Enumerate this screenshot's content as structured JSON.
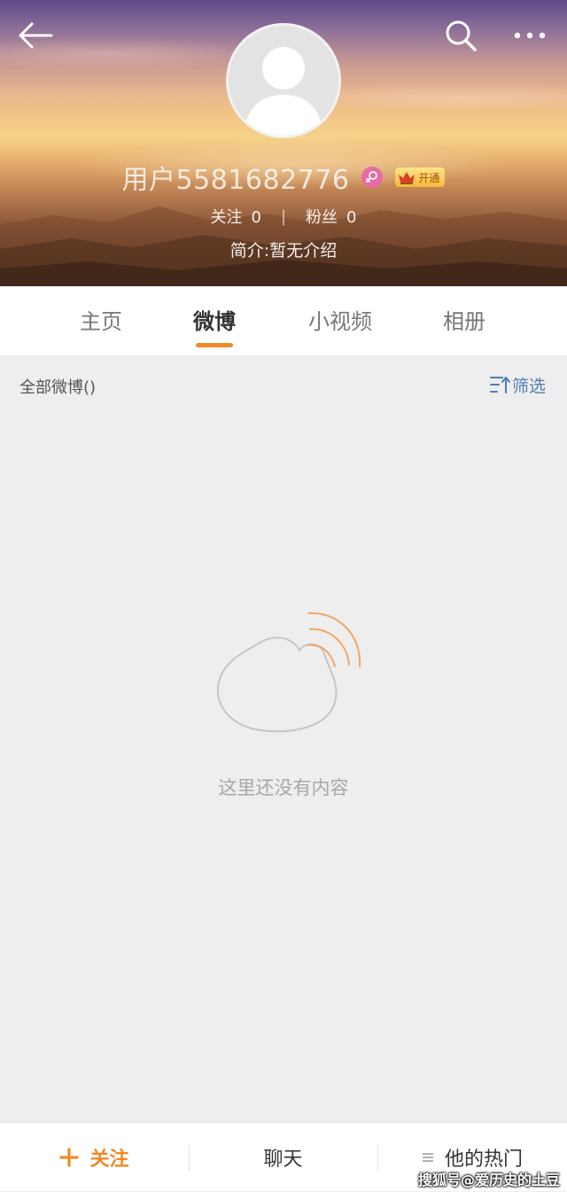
{
  "profile": {
    "username": "用户5581682776",
    "follow_label": "关注",
    "follow_count": "0",
    "fans_label": "粉丝",
    "fans_count": "0",
    "stats_separator": "|",
    "bio": "简介:暂无介绍",
    "vip_label": "开通"
  },
  "tabs": [
    {
      "label": "主页"
    },
    {
      "label": "微博",
      "active": true
    },
    {
      "label": "小视频"
    },
    {
      "label": "相册"
    }
  ],
  "feed": {
    "all_label": "全部微博()",
    "filter_label": "筛选",
    "empty_text": "这里还没有内容"
  },
  "bottom_bar": {
    "follow_label": "关注",
    "chat_label": "聊天",
    "hot_label": "他的热门"
  },
  "watermark": "搜狐号@爱历史的土豆",
  "colors": {
    "accent_orange": "#f08a26",
    "link_blue": "#4e7eb8",
    "female_pink": "#e86aa6"
  },
  "icons": [
    "back-arrow-icon",
    "search-icon",
    "more-icon",
    "avatar-placeholder-icon",
    "female-icon",
    "crown-icon",
    "filter-icon",
    "empty-state-icon",
    "plus-icon",
    "menu-lines-icon"
  ]
}
